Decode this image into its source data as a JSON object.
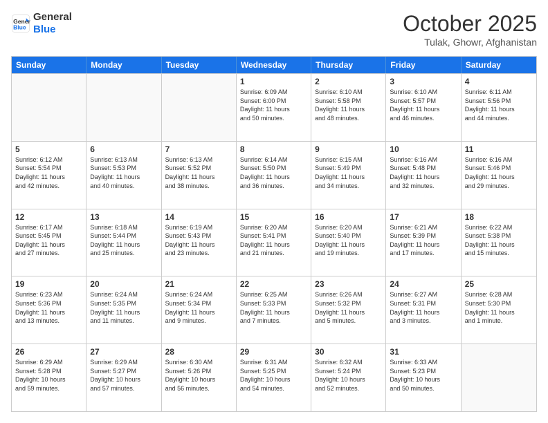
{
  "header": {
    "logo_line1": "General",
    "logo_line2": "Blue",
    "month_title": "October 2025",
    "location": "Tulak, Ghowr, Afghanistan"
  },
  "days_of_week": [
    "Sunday",
    "Monday",
    "Tuesday",
    "Wednesday",
    "Thursday",
    "Friday",
    "Saturday"
  ],
  "weeks": [
    [
      {
        "day": "",
        "info": ""
      },
      {
        "day": "",
        "info": ""
      },
      {
        "day": "",
        "info": ""
      },
      {
        "day": "1",
        "info": "Sunrise: 6:09 AM\nSunset: 6:00 PM\nDaylight: 11 hours\nand 50 minutes."
      },
      {
        "day": "2",
        "info": "Sunrise: 6:10 AM\nSunset: 5:58 PM\nDaylight: 11 hours\nand 48 minutes."
      },
      {
        "day": "3",
        "info": "Sunrise: 6:10 AM\nSunset: 5:57 PM\nDaylight: 11 hours\nand 46 minutes."
      },
      {
        "day": "4",
        "info": "Sunrise: 6:11 AM\nSunset: 5:56 PM\nDaylight: 11 hours\nand 44 minutes."
      }
    ],
    [
      {
        "day": "5",
        "info": "Sunrise: 6:12 AM\nSunset: 5:54 PM\nDaylight: 11 hours\nand 42 minutes."
      },
      {
        "day": "6",
        "info": "Sunrise: 6:13 AM\nSunset: 5:53 PM\nDaylight: 11 hours\nand 40 minutes."
      },
      {
        "day": "7",
        "info": "Sunrise: 6:13 AM\nSunset: 5:52 PM\nDaylight: 11 hours\nand 38 minutes."
      },
      {
        "day": "8",
        "info": "Sunrise: 6:14 AM\nSunset: 5:50 PM\nDaylight: 11 hours\nand 36 minutes."
      },
      {
        "day": "9",
        "info": "Sunrise: 6:15 AM\nSunset: 5:49 PM\nDaylight: 11 hours\nand 34 minutes."
      },
      {
        "day": "10",
        "info": "Sunrise: 6:16 AM\nSunset: 5:48 PM\nDaylight: 11 hours\nand 32 minutes."
      },
      {
        "day": "11",
        "info": "Sunrise: 6:16 AM\nSunset: 5:46 PM\nDaylight: 11 hours\nand 29 minutes."
      }
    ],
    [
      {
        "day": "12",
        "info": "Sunrise: 6:17 AM\nSunset: 5:45 PM\nDaylight: 11 hours\nand 27 minutes."
      },
      {
        "day": "13",
        "info": "Sunrise: 6:18 AM\nSunset: 5:44 PM\nDaylight: 11 hours\nand 25 minutes."
      },
      {
        "day": "14",
        "info": "Sunrise: 6:19 AM\nSunset: 5:43 PM\nDaylight: 11 hours\nand 23 minutes."
      },
      {
        "day": "15",
        "info": "Sunrise: 6:20 AM\nSunset: 5:41 PM\nDaylight: 11 hours\nand 21 minutes."
      },
      {
        "day": "16",
        "info": "Sunrise: 6:20 AM\nSunset: 5:40 PM\nDaylight: 11 hours\nand 19 minutes."
      },
      {
        "day": "17",
        "info": "Sunrise: 6:21 AM\nSunset: 5:39 PM\nDaylight: 11 hours\nand 17 minutes."
      },
      {
        "day": "18",
        "info": "Sunrise: 6:22 AM\nSunset: 5:38 PM\nDaylight: 11 hours\nand 15 minutes."
      }
    ],
    [
      {
        "day": "19",
        "info": "Sunrise: 6:23 AM\nSunset: 5:36 PM\nDaylight: 11 hours\nand 13 minutes."
      },
      {
        "day": "20",
        "info": "Sunrise: 6:24 AM\nSunset: 5:35 PM\nDaylight: 11 hours\nand 11 minutes."
      },
      {
        "day": "21",
        "info": "Sunrise: 6:24 AM\nSunset: 5:34 PM\nDaylight: 11 hours\nand 9 minutes."
      },
      {
        "day": "22",
        "info": "Sunrise: 6:25 AM\nSunset: 5:33 PM\nDaylight: 11 hours\nand 7 minutes."
      },
      {
        "day": "23",
        "info": "Sunrise: 6:26 AM\nSunset: 5:32 PM\nDaylight: 11 hours\nand 5 minutes."
      },
      {
        "day": "24",
        "info": "Sunrise: 6:27 AM\nSunset: 5:31 PM\nDaylight: 11 hours\nand 3 minutes."
      },
      {
        "day": "25",
        "info": "Sunrise: 6:28 AM\nSunset: 5:30 PM\nDaylight: 11 hours\nand 1 minute."
      }
    ],
    [
      {
        "day": "26",
        "info": "Sunrise: 6:29 AM\nSunset: 5:28 PM\nDaylight: 10 hours\nand 59 minutes."
      },
      {
        "day": "27",
        "info": "Sunrise: 6:29 AM\nSunset: 5:27 PM\nDaylight: 10 hours\nand 57 minutes."
      },
      {
        "day": "28",
        "info": "Sunrise: 6:30 AM\nSunset: 5:26 PM\nDaylight: 10 hours\nand 56 minutes."
      },
      {
        "day": "29",
        "info": "Sunrise: 6:31 AM\nSunset: 5:25 PM\nDaylight: 10 hours\nand 54 minutes."
      },
      {
        "day": "30",
        "info": "Sunrise: 6:32 AM\nSunset: 5:24 PM\nDaylight: 10 hours\nand 52 minutes."
      },
      {
        "day": "31",
        "info": "Sunrise: 6:33 AM\nSunset: 5:23 PM\nDaylight: 10 hours\nand 50 minutes."
      },
      {
        "day": "",
        "info": ""
      }
    ]
  ]
}
